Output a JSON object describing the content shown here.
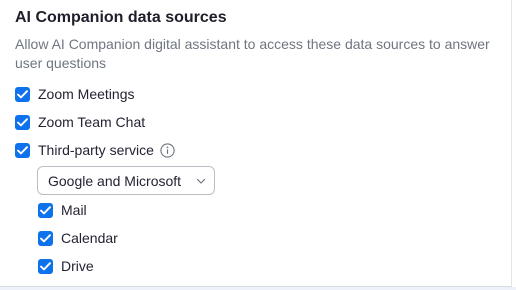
{
  "section": {
    "title": "AI Companion data sources",
    "description": "Allow AI Companion digital assistant to access these data sources to answer user questions"
  },
  "sources": [
    {
      "label": "Zoom Meetings",
      "checked": true
    },
    {
      "label": "Zoom Team Chat",
      "checked": true
    },
    {
      "label": "Third-party service",
      "checked": true
    }
  ],
  "third_party": {
    "provider_selected": "Google and Microsoft",
    "items": [
      {
        "label": "Mail",
        "checked": true
      },
      {
        "label": "Calendar",
        "checked": true
      },
      {
        "label": "Drive",
        "checked": true
      }
    ]
  },
  "icons": {
    "checkbox": "checkmark-icon",
    "info": "info-icon",
    "dropdown": "chevron-down-icon"
  },
  "colors": {
    "accent": "#0e72ed",
    "title": "#1f1f2b",
    "description": "#6e7680"
  }
}
